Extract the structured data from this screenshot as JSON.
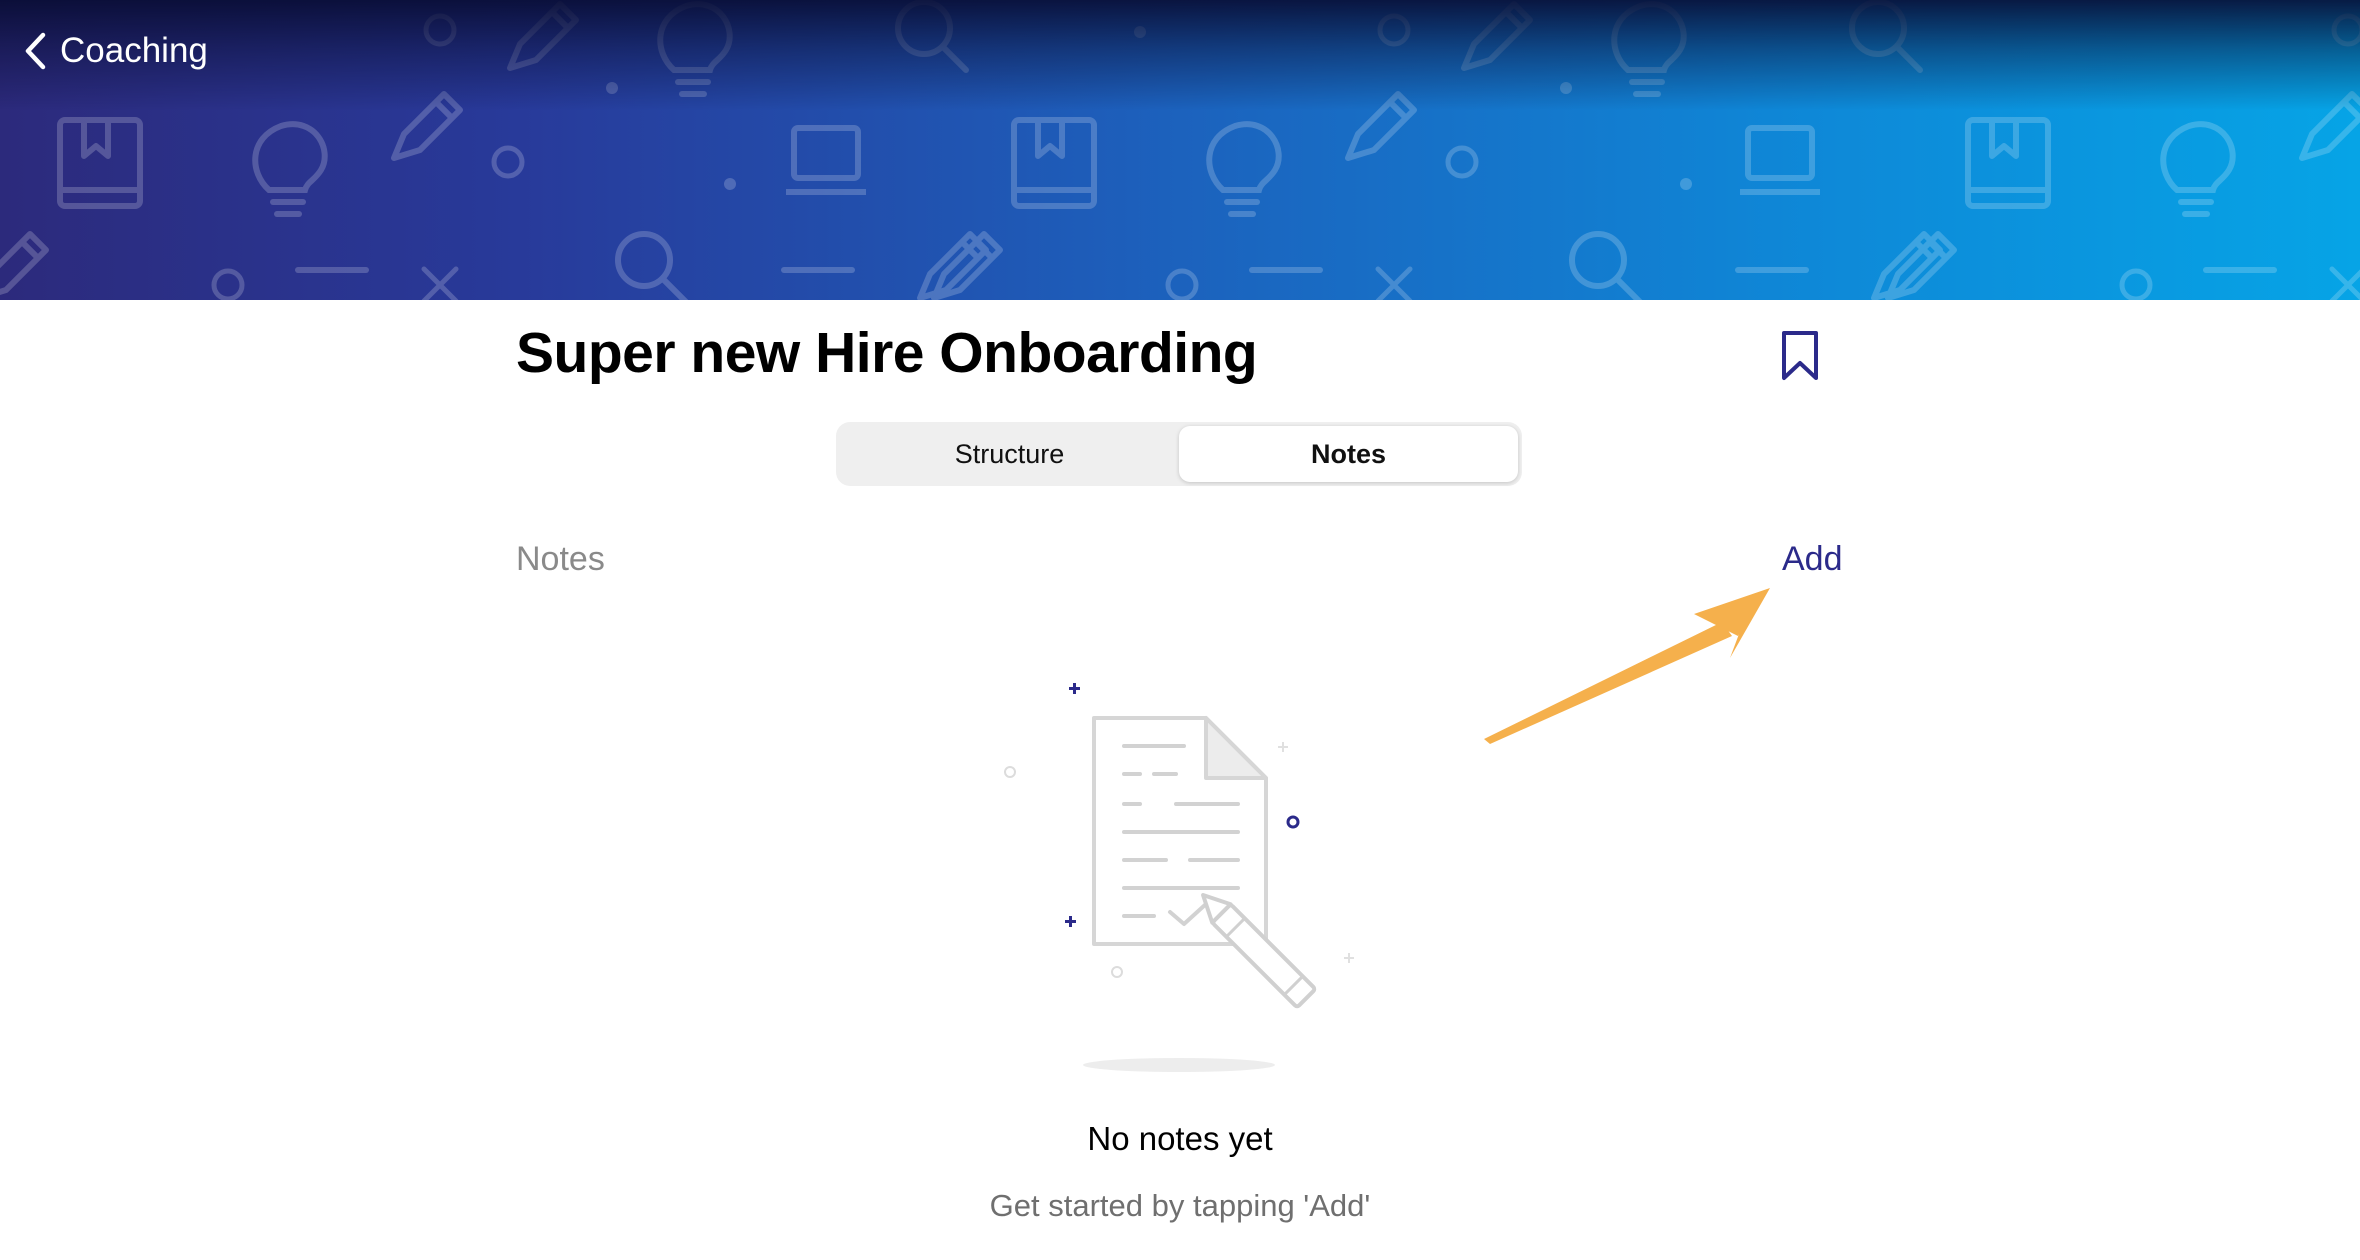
{
  "header": {
    "back_label": "Coaching"
  },
  "page": {
    "title": "Super new Hire Onboarding"
  },
  "tabs": [
    {
      "label": "Structure",
      "selected": false
    },
    {
      "label": "Notes",
      "selected": true
    }
  ],
  "notes": {
    "section_label": "Notes",
    "add_label": "Add",
    "empty_title": "No notes yet",
    "empty_subtitle": "Get started by tapping 'Add'"
  },
  "colors": {
    "accent": "#2b2a8a",
    "annotation_arrow": "#f5b04c",
    "banner_start": "#2c2a7c",
    "banner_end": "#06a4e6"
  },
  "icons": {
    "back": "chevron-left-icon",
    "bookmark": "bookmark-icon",
    "empty_state": "document-pencil-illustration"
  }
}
